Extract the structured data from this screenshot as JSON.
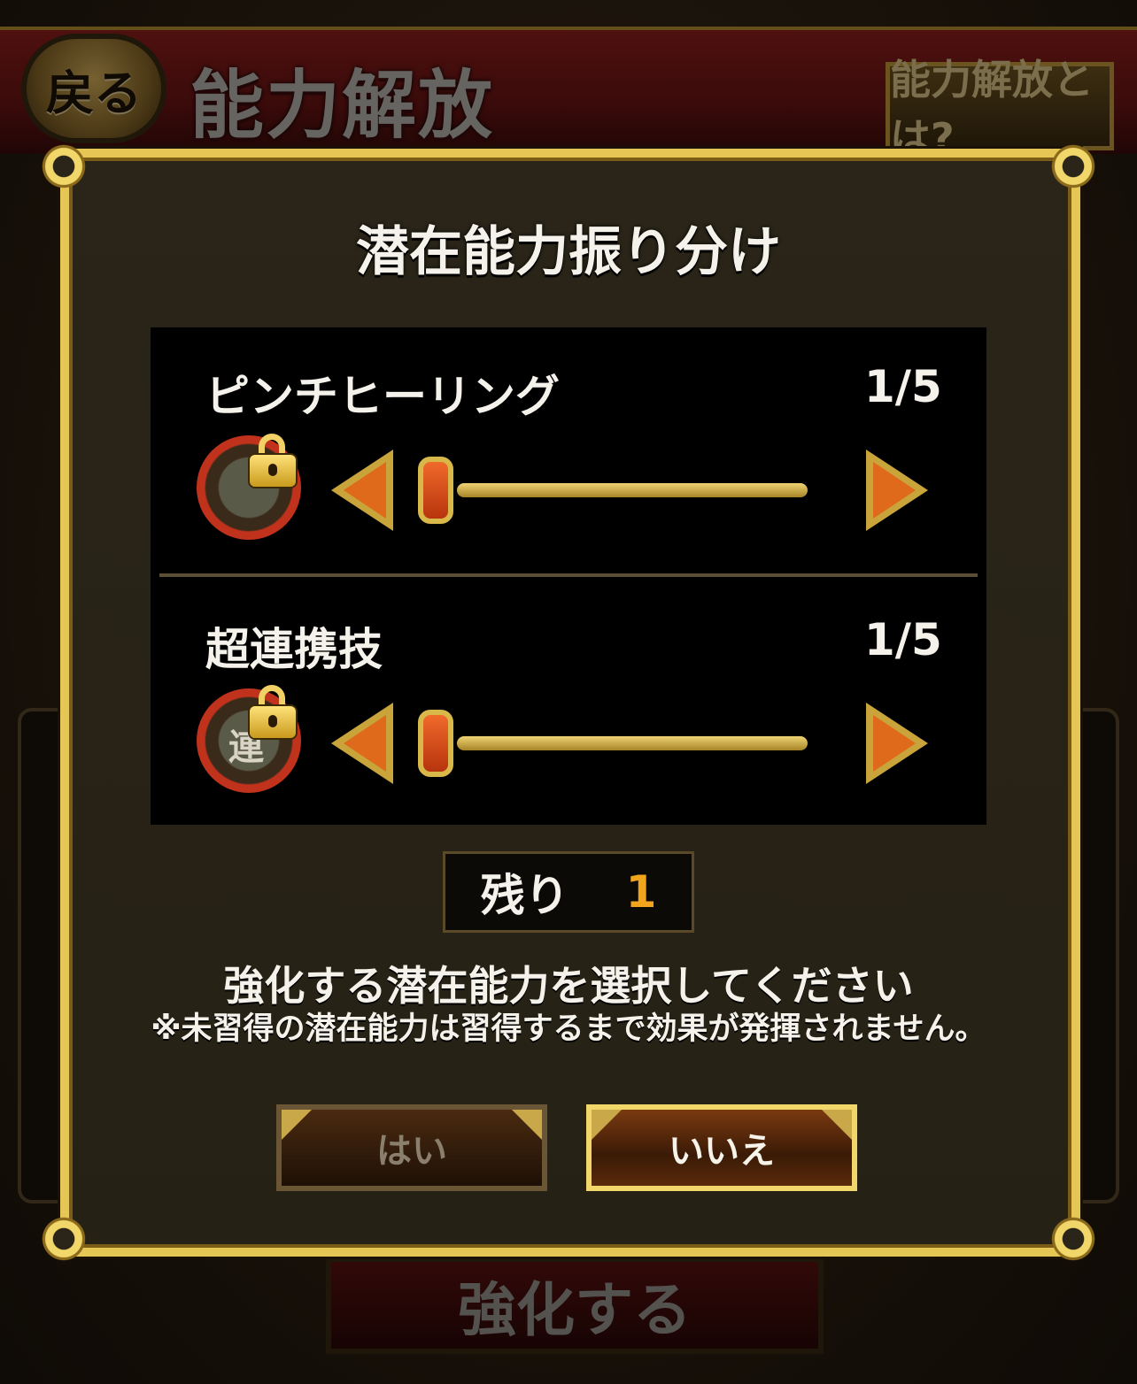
{
  "header": {
    "back_label": "戻る",
    "title": "能力解放",
    "help_label": "能力解放とは?"
  },
  "background": {
    "enhance_label": "強化する"
  },
  "dialog": {
    "title": "潜在能力振り分け",
    "skills": [
      {
        "name": "ピンチヒーリング",
        "count": "1/5",
        "icon": "pinch-healing-icon",
        "locked": true,
        "level": 1,
        "max": 5
      },
      {
        "name": "超連携技",
        "count": "1/5",
        "icon": "combo-attack-icon",
        "icon_text": "連",
        "locked": true,
        "level": 1,
        "max": 5
      }
    ],
    "remaining_label": "残り",
    "remaining_value": "1",
    "instruction": "強化する潜在能力を選択してください",
    "note": "※未習得の潜在能力は習得するまで効果が発揮されません。",
    "yes_label": "はい",
    "no_label": "いいえ"
  },
  "colors": {
    "frame_gold": "#e6c655",
    "accent_orange": "#e06a1c",
    "remaining_value": "#f0a51c"
  }
}
